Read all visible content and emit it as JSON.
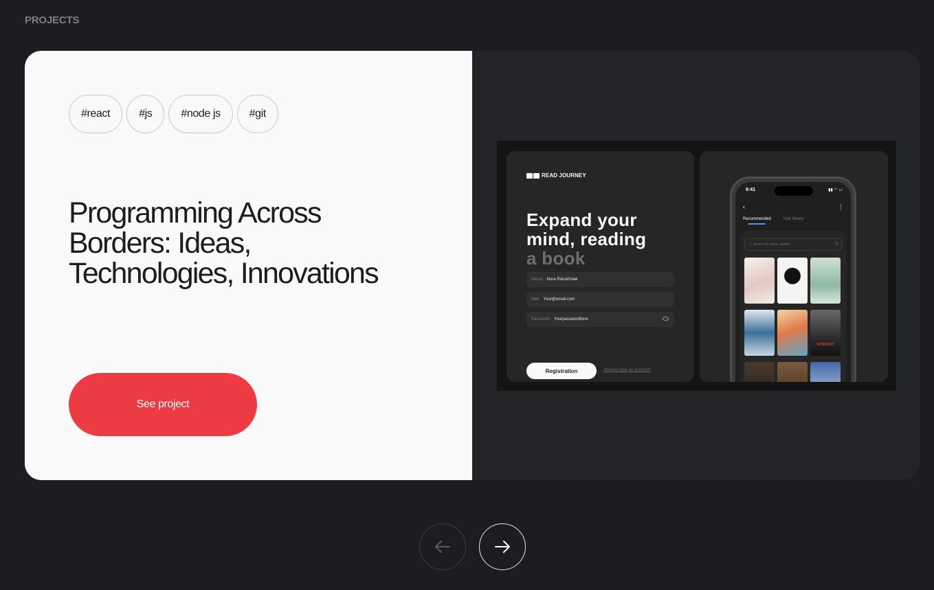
{
  "section": {
    "title": "PROJECTS"
  },
  "project": {
    "tags": [
      "#react",
      "#js",
      "#node js",
      "#git"
    ],
    "title": "Programming Across Borders: Ideas, Technologies, Innovations",
    "cta_label": "See project",
    "cta_color": "#ed3b44"
  },
  "preview": {
    "logo_text": "READ JOURNEY",
    "hero_line1": "Expand your",
    "hero_line2": "mind, reading",
    "hero_line3": "a book",
    "fields": [
      {
        "label": "Name:",
        "value": "Ilona Ratushniak"
      },
      {
        "label": "Mail:",
        "value": "Your@email.com"
      },
      {
        "label": "Password:",
        "value": "Yourpasswordhere"
      }
    ],
    "register_label": "Registration",
    "login_link": "Already have an account?",
    "phone": {
      "time": "9:41",
      "tab_recommended": "Recommended",
      "tab_library": "Your library",
      "search_placeholder": "Search by name, author...",
      "book_caption": "ІНТЕРНАТ"
    }
  },
  "nav": {
    "prev_icon": "arrow-left-icon",
    "next_icon": "arrow-right-icon"
  },
  "colors": {
    "background": "#1c1d20",
    "card_light": "#f9f9f9",
    "card_dark": "#232427"
  }
}
